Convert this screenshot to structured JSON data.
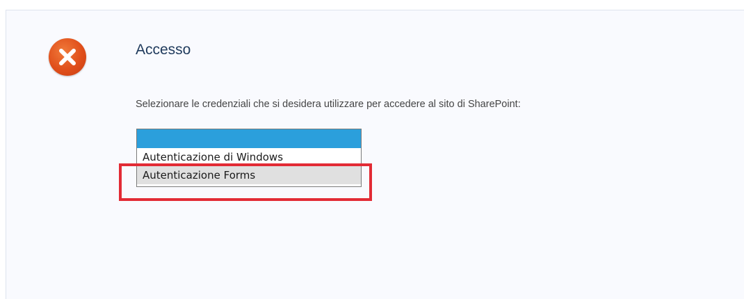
{
  "dialog": {
    "title": "Accesso",
    "icon": "error-icon",
    "instruction": "Selezionare le credenziali che si desidera utilizzare per accedere al sito di SharePoint:"
  },
  "credentials_list": {
    "options": [
      {
        "label": ""
      },
      {
        "label": "Autenticazione di Windows"
      },
      {
        "label": "Autenticazione Forms"
      }
    ],
    "selected_index": 0,
    "highlighted_option": "Autenticazione Forms"
  },
  "colors": {
    "icon": "#e04f1b",
    "title": "#1f3a5c",
    "selection": "#2b9fdc",
    "annotation": "#e22b35"
  }
}
